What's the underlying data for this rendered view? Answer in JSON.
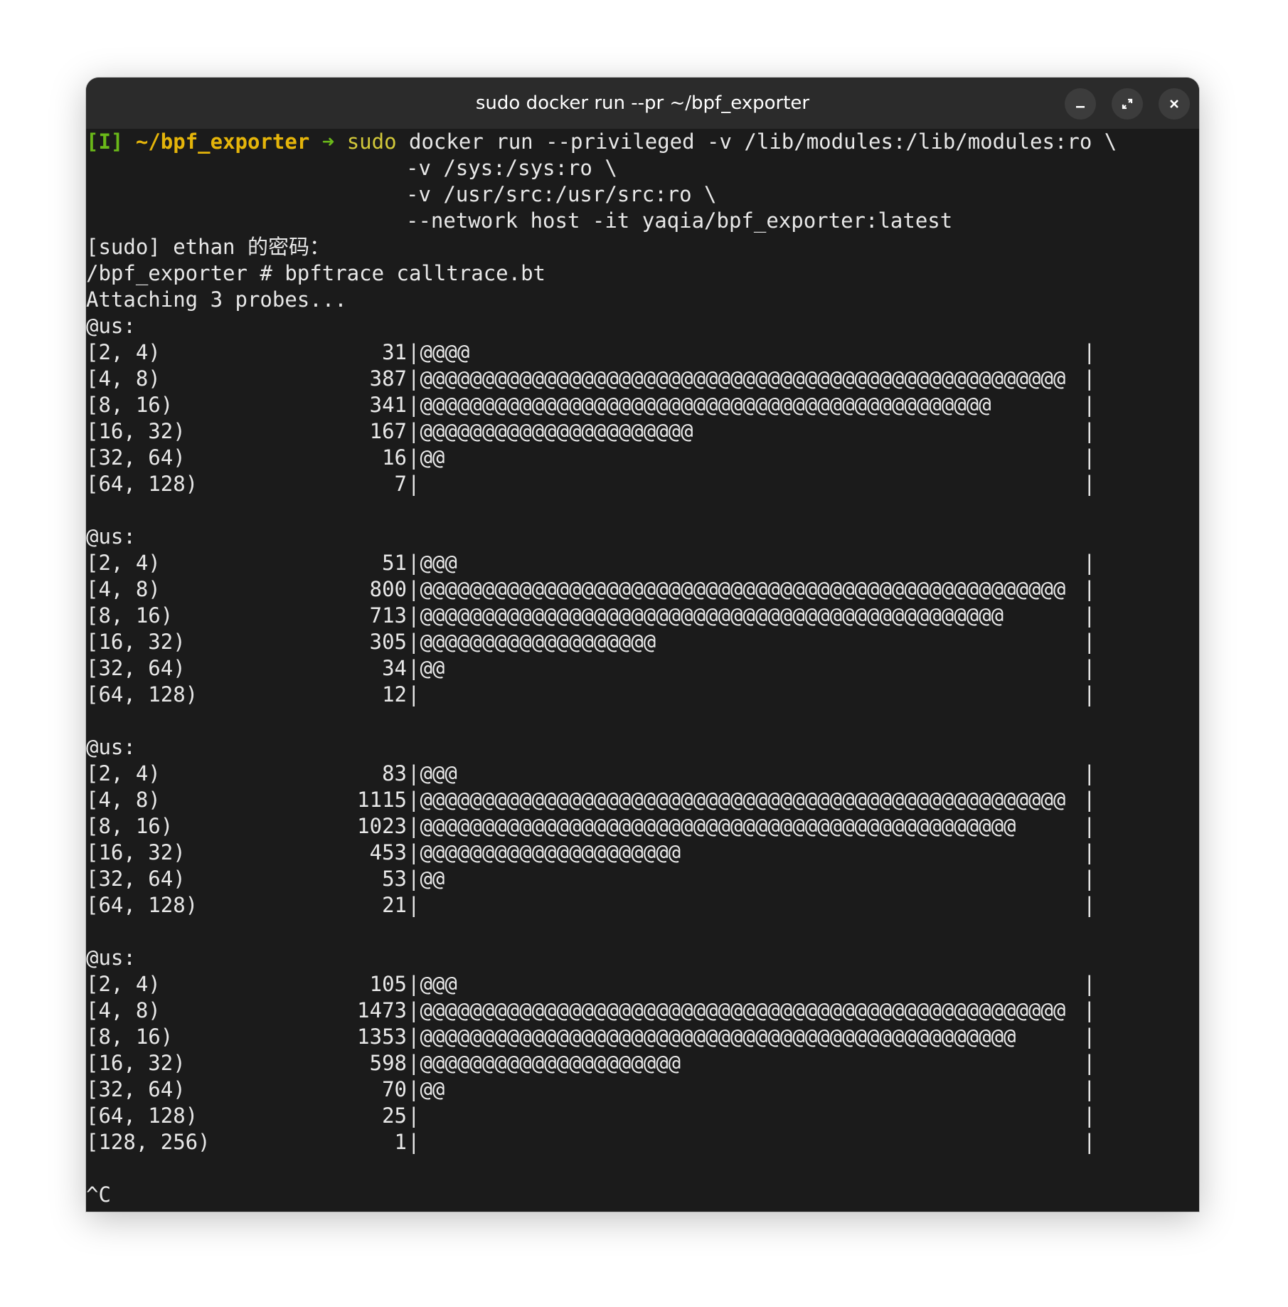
{
  "window": {
    "title": "sudo docker run --pr ~/bpf_exporter",
    "minimize_label": "–",
    "maximize_label": "⤢",
    "close_label": "✕"
  },
  "prompt": {
    "tag": "[I]",
    "cwd": "~/bpf_exporter",
    "arrow": "➜",
    "cmd_sudo": "sudo",
    "cmd_rest": "docker run --privileged -v /lib/modules:/lib/modules:ro \\",
    "cont1": "-v /sys:/sys:ro \\",
    "cont2": "-v /usr/src:/usr/src:ro \\",
    "cont3": "--network host -it yaqia/bpf_exporter:latest"
  },
  "output": {
    "sudo_prompt": "[sudo] ethan 的密码：",
    "shell_cmd": "/bpf_exporter # bpftrace calltrace.bt",
    "attaching": "Attaching 3 probes...",
    "interrupt": "^C"
  },
  "histograms": [
    {
      "label": "@us:",
      "rows": [
        {
          "range": "[2, 4)",
          "count": "31",
          "bar": "|@@@@",
          "end": "|"
        },
        {
          "range": "[4, 8)",
          "count": "387",
          "bar": "|@@@@@@@@@@@@@@@@@@@@@@@@@@@@@@@@@@@@@@@@@@@@@@@@@@@@",
          "end": "|"
        },
        {
          "range": "[8, 16)",
          "count": "341",
          "bar": "|@@@@@@@@@@@@@@@@@@@@@@@@@@@@@@@@@@@@@@@@@@@@@@",
          "end": "|"
        },
        {
          "range": "[16, 32)",
          "count": "167",
          "bar": "|@@@@@@@@@@@@@@@@@@@@@@",
          "end": "|"
        },
        {
          "range": "[32, 64)",
          "count": "16",
          "bar": "|@@",
          "end": "|"
        },
        {
          "range": "[64, 128)",
          "count": "7",
          "bar": "|",
          "end": "|"
        }
      ]
    },
    {
      "label": "@us:",
      "rows": [
        {
          "range": "[2, 4)",
          "count": "51",
          "bar": "|@@@",
          "end": "|"
        },
        {
          "range": "[4, 8)",
          "count": "800",
          "bar": "|@@@@@@@@@@@@@@@@@@@@@@@@@@@@@@@@@@@@@@@@@@@@@@@@@@@@",
          "end": "|"
        },
        {
          "range": "[8, 16)",
          "count": "713",
          "bar": "|@@@@@@@@@@@@@@@@@@@@@@@@@@@@@@@@@@@@@@@@@@@@@@@",
          "end": "|"
        },
        {
          "range": "[16, 32)",
          "count": "305",
          "bar": "|@@@@@@@@@@@@@@@@@@@",
          "end": "|"
        },
        {
          "range": "[32, 64)",
          "count": "34",
          "bar": "|@@",
          "end": "|"
        },
        {
          "range": "[64, 128)",
          "count": "12",
          "bar": "|",
          "end": "|"
        }
      ]
    },
    {
      "label": "@us:",
      "rows": [
        {
          "range": "[2, 4)",
          "count": "83",
          "bar": "|@@@",
          "end": "|"
        },
        {
          "range": "[4, 8)",
          "count": "1115",
          "bar": "|@@@@@@@@@@@@@@@@@@@@@@@@@@@@@@@@@@@@@@@@@@@@@@@@@@@@",
          "end": "|"
        },
        {
          "range": "[8, 16)",
          "count": "1023",
          "bar": "|@@@@@@@@@@@@@@@@@@@@@@@@@@@@@@@@@@@@@@@@@@@@@@@@",
          "end": "|"
        },
        {
          "range": "[16, 32)",
          "count": "453",
          "bar": "|@@@@@@@@@@@@@@@@@@@@@",
          "end": "|"
        },
        {
          "range": "[32, 64)",
          "count": "53",
          "bar": "|@@",
          "end": "|"
        },
        {
          "range": "[64, 128)",
          "count": "21",
          "bar": "|",
          "end": "|"
        }
      ]
    },
    {
      "label": "@us:",
      "rows": [
        {
          "range": "[2, 4)",
          "count": "105",
          "bar": "|@@@",
          "end": "|"
        },
        {
          "range": "[4, 8)",
          "count": "1473",
          "bar": "|@@@@@@@@@@@@@@@@@@@@@@@@@@@@@@@@@@@@@@@@@@@@@@@@@@@@",
          "end": "|"
        },
        {
          "range": "[8, 16)",
          "count": "1353",
          "bar": "|@@@@@@@@@@@@@@@@@@@@@@@@@@@@@@@@@@@@@@@@@@@@@@@@",
          "end": "|"
        },
        {
          "range": "[16, 32)",
          "count": "598",
          "bar": "|@@@@@@@@@@@@@@@@@@@@@",
          "end": "|"
        },
        {
          "range": "[32, 64)",
          "count": "70",
          "bar": "|@@",
          "end": "|"
        },
        {
          "range": "[64, 128)",
          "count": "25",
          "bar": "|",
          "end": "|"
        },
        {
          "range": "[128, 256)",
          "count": "1",
          "bar": "|",
          "end": "|"
        }
      ]
    }
  ],
  "colors": {
    "terminal_bg": "#1b1b1b",
    "titlebar_bg": "#2b2b2b",
    "text": "#e8e8e8",
    "prompt_tag": "#6ab819",
    "prompt_cwd": "#e5b50a",
    "prompt_sudo": "#d3c93a"
  }
}
